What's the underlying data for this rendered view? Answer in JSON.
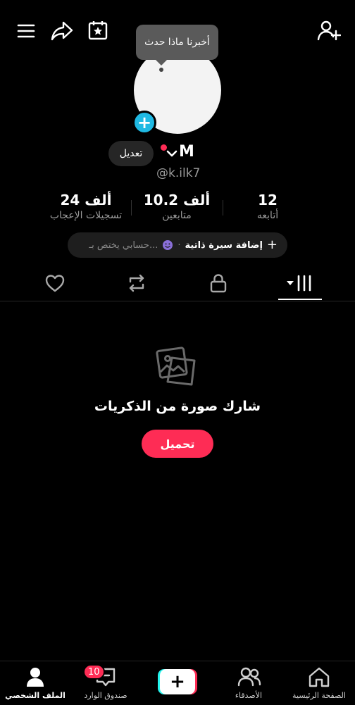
{
  "top_bar": {
    "menu_icon": "hamburger-menu-icon",
    "share_icon": "share-arrow-icon",
    "calendar_icon": "calendar-star-icon",
    "add_friend_icon": "add-user-icon"
  },
  "tooltip": {
    "text": "أخبرنا ماذا حدث"
  },
  "profile": {
    "display_name": "M",
    "username": "@k.ilk7",
    "edit_label": "تعديل"
  },
  "stats": {
    "following": {
      "value": "12",
      "label": "أتابعه"
    },
    "followers": {
      "value": "10.2 ألف",
      "label": "متابعين"
    },
    "likes": {
      "value": "24 ألف",
      "label": "تسجيلات الإعجاب"
    }
  },
  "bio": {
    "add_label": "إضافة سيرة ذاتية",
    "separator": "·",
    "hint": "حسابي يختص بـ..."
  },
  "tabs": [
    {
      "name": "videos",
      "icon": "grid-icon"
    },
    {
      "name": "private",
      "icon": "lock-icon"
    },
    {
      "name": "reposts",
      "icon": "repost-icon"
    },
    {
      "name": "liked",
      "icon": "heart-icon"
    }
  ],
  "empty_state": {
    "icon": "photos-icon",
    "title": "شارك صورة من الذكريات",
    "button": "تحميل"
  },
  "bottom_nav": {
    "home": "الصفحة الرئيسية",
    "friends": "الأصدقاء",
    "inbox": "صندوق الوارد",
    "inbox_badge": "10",
    "profile": "الملف الشخصي"
  },
  "colors": {
    "accent": "#fe2c55",
    "cyan": "#25f4ee",
    "avatar_add": "#1fb9e3",
    "background": "#000000"
  }
}
